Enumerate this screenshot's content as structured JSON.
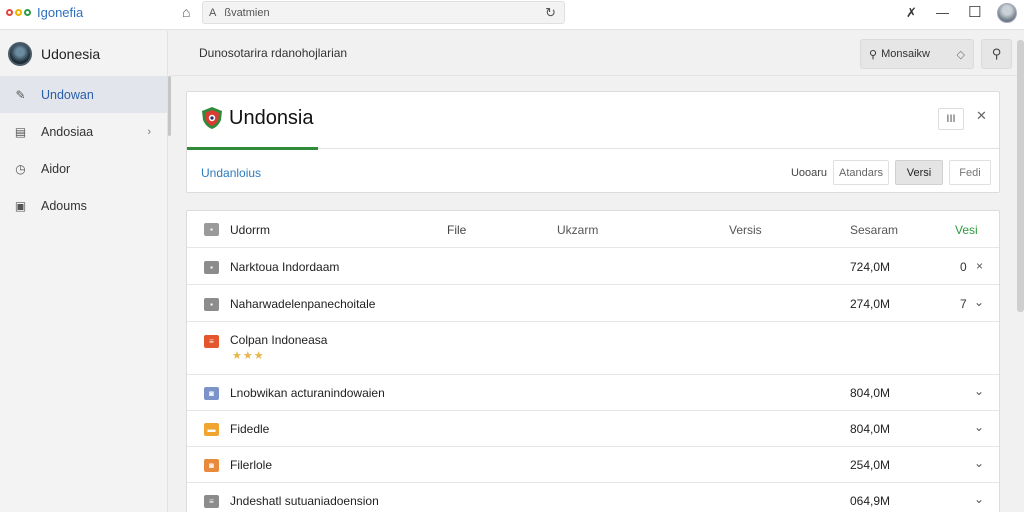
{
  "browser": {
    "title": "Igonefia",
    "address": "ßvatmien",
    "logo_colors": [
      "#e5443b",
      "#f0b400",
      "#2f9a47",
      "#2f6fbf"
    ]
  },
  "account": {
    "name": "Udonesia"
  },
  "sidebar": {
    "items": [
      {
        "label": "Undowan",
        "icon": "edit-icon",
        "active": true
      },
      {
        "label": "Andosiaa",
        "icon": "document-icon",
        "chevron": true
      },
      {
        "label": "Aidor",
        "icon": "clock-icon"
      },
      {
        "label": "Adoums",
        "icon": "image-icon"
      }
    ]
  },
  "main": {
    "title": "Dunosotarira rdanohojlarian",
    "search_label": "Monsaikw"
  },
  "panel": {
    "title": "Undonsia",
    "button_label": "III",
    "tab_label": "Undanloius",
    "options": [
      "Uooaru",
      "Atandars",
      "Versi",
      "Fedi"
    ],
    "active_option": "Versi",
    "accent": "#2f8a3a"
  },
  "table": {
    "headers": [
      "Udorrm",
      "File",
      "Ukzarm",
      "Versis",
      "Sesaram",
      "Vesi"
    ],
    "header_accent": "#2f9a3a",
    "rows": [
      {
        "name": "Narktoua Indordaam",
        "size": "724,0M",
        "end": "0",
        "action": "×",
        "icon": "folder-icon",
        "color": "#8c8c8c"
      },
      {
        "name": "Naharwadelenpanechoitale",
        "size": "274,0M",
        "end": "7",
        "action": "⌄",
        "icon": "folder-icon",
        "color": "#8c8c8c"
      },
      {
        "name": "Colpan Indoneasa",
        "size": "",
        "end": "",
        "action": "",
        "icon": "document-icon",
        "color": "#e4572e",
        "stars": "★★★"
      },
      {
        "name": "Lnobwikan acturanindowaien",
        "size": "804,0M",
        "end": "",
        "action": "⌄",
        "icon": "image-icon",
        "color": "#7b93c9"
      },
      {
        "name": "Fidedle",
        "size": "804,0M",
        "end": "",
        "action": "⌄",
        "icon": "folder-icon",
        "color": "#efa530"
      },
      {
        "name": "Filerlole",
        "size": "254,0M",
        "end": "",
        "action": "⌄",
        "icon": "image-icon",
        "color": "#e88a3c"
      },
      {
        "name": "Jndeshatl sutuaniadoension",
        "size": "064,9M",
        "end": "",
        "action": "⌄",
        "icon": "document-icon",
        "color": "#8c8c8c"
      }
    ]
  }
}
